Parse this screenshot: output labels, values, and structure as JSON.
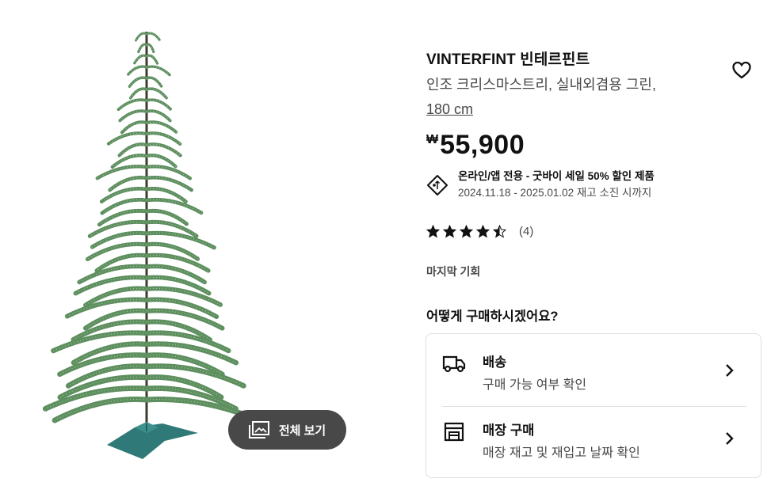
{
  "product": {
    "name": "VINTERFINT 빈테르핀트",
    "description": "인조 크리스마스트리, 실내외겸용 그린,",
    "size": "180 cm"
  },
  "price": {
    "currency": "₩",
    "amount": "55,900"
  },
  "promo": {
    "title": "온라인/앱 전용 - 굿바이 세일 50% 할인 제품",
    "period": "2024.11.18 - 2025.01.02 재고 소진 시까지"
  },
  "rating": {
    "value": 4.5,
    "count": "(4)"
  },
  "badge": "마지막 기회",
  "purchase": {
    "heading": "어떻게 구매하시겠어요?",
    "delivery": {
      "title": "배송",
      "subtitle": "구매 가능 여부 확인"
    },
    "store": {
      "title": "매장 구매",
      "subtitle": "매장 재고 및 재입고 날짜 확인"
    }
  },
  "gallery": {
    "view_all_label": "전체 보기"
  },
  "colors": {
    "button_dark": "#484848",
    "text_secondary": "#484848",
    "tree_green": "#4f8a5b",
    "stand_teal": "#2f7a78"
  },
  "icons": [
    "heart-icon",
    "tag-icon",
    "star-icon",
    "truck-icon",
    "store-icon",
    "chevron-right-icon",
    "image-gallery-icon"
  ]
}
